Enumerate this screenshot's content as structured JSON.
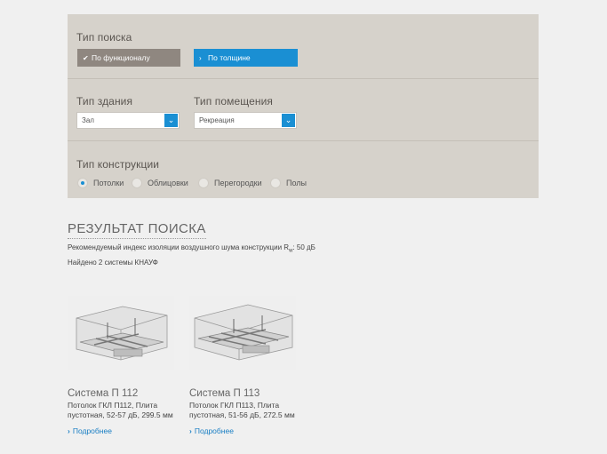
{
  "filters": {
    "search_type": {
      "title": "Тип поиска",
      "by_function": "По функционалу",
      "by_thickness": "По толщине"
    },
    "building_type": {
      "title": "Тип здания",
      "value": "Зал"
    },
    "room_type": {
      "title": "Тип помещения",
      "value": "Рекреация"
    },
    "construction_type": {
      "title": "Тип конструкции",
      "options": [
        "Потолки",
        "Облицовки",
        "Перегородки",
        "Полы"
      ],
      "selected": "Потолки"
    }
  },
  "results": {
    "title": "РЕЗУЛЬТАТ ПОИСКА",
    "recommend_prefix": "Рекомендуемый индекс изоляции воздушного шума конструкции R",
    "recommend_sub": "w",
    "recommend_suffix": ": 50 дБ",
    "found": "Найдено 2 системы КНАУФ",
    "cards": [
      {
        "name": "Система П 112",
        "desc": "Потолок ГКЛ П112, Плита пустотная, 52-57 дБ, 299.5 мм",
        "more": "Подробнее"
      },
      {
        "name": "Система П 113",
        "desc": "Потолок ГКЛ П113, Плита пустотная, 51-56 дБ, 272.5 мм",
        "more": "Подробнее"
      }
    ]
  },
  "colors": {
    "accent": "#1a8fd3",
    "panel": "#d6d2cb",
    "button_gray": "#8f8780"
  },
  "icons": {
    "check": "check-icon",
    "chevron_right": "chevron-right-icon",
    "chevron_down": "chevron-down-icon"
  }
}
